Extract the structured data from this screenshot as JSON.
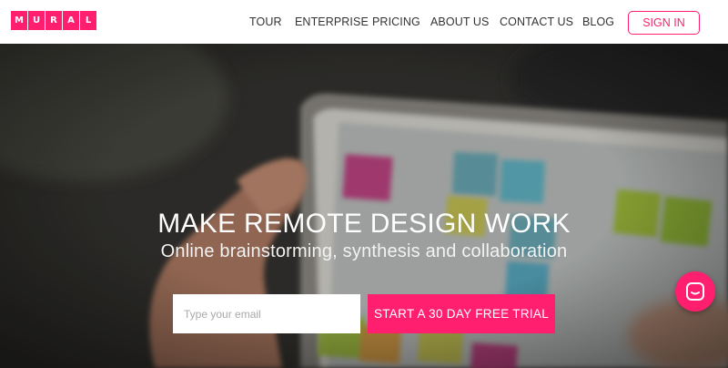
{
  "brand": {
    "logo_letters": [
      "M",
      "U",
      "R",
      "A",
      "L"
    ],
    "accent_color": "#ff1f6e"
  },
  "nav": {
    "tour": "TOUR",
    "enterprise": "ENTERPRISE",
    "pricing": "PRICING",
    "about": "ABOUT US",
    "contact": "CONTACT US",
    "blog": "BLOG",
    "sign_in": "SIGN IN"
  },
  "hero": {
    "headline": "MAKE REMOTE DESIGN WORK",
    "subheadline": "Online brainstorming, synthesis and collaboration",
    "email_placeholder": "Type your email",
    "email_value": "",
    "cta_label": "START A 30 DAY FREE TRIAL"
  },
  "chat_widget": {
    "icon": "chat-bubble-icon"
  }
}
